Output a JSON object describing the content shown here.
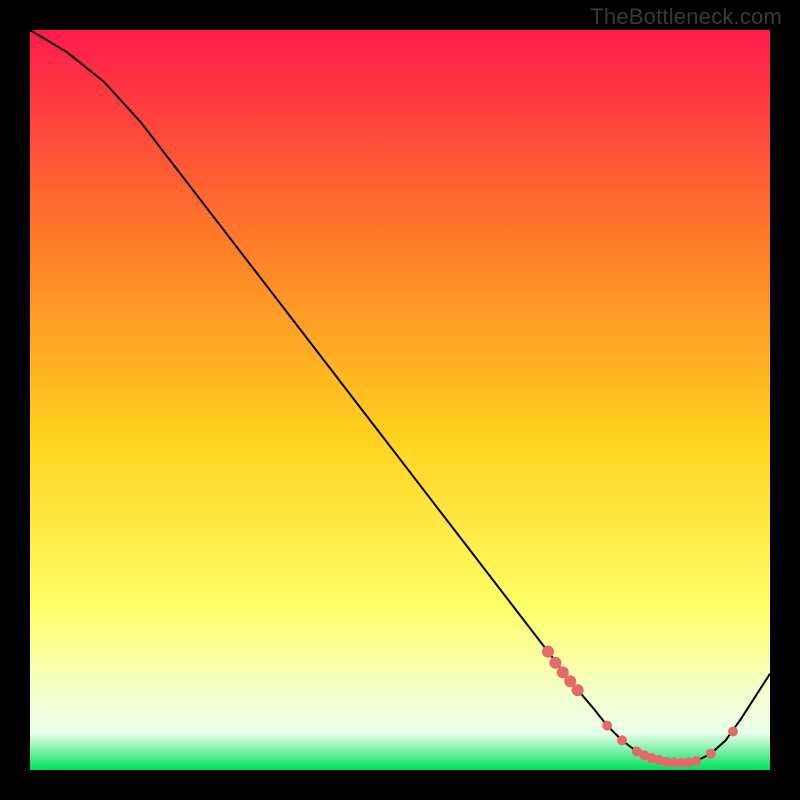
{
  "watermark": "TheBottleneck.com",
  "colors": {
    "gradient_top": "#ff1a4b",
    "gradient_mid1": "#ff7a2a",
    "gradient_mid2": "#ffd21f",
    "gradient_mid3": "#ffff66",
    "gradient_bottom_pale": "#eaffea",
    "gradient_bottom": "#00e05a",
    "curve": "#000000",
    "marker": "#e56a6a"
  },
  "chart_data": {
    "type": "line",
    "title": "",
    "xlabel": "",
    "ylabel": "",
    "xlim": [
      0,
      100
    ],
    "ylim": [
      0,
      100
    ],
    "grid": false,
    "legend": false,
    "series": [
      {
        "name": "bottleneck-curve",
        "x": [
          0,
          5,
          10,
          15,
          20,
          25,
          30,
          35,
          40,
          45,
          50,
          55,
          60,
          65,
          70,
          73,
          76,
          78,
          80,
          82,
          84,
          86,
          88,
          90,
          92,
          94,
          96,
          100
        ],
        "y": [
          100,
          97,
          93,
          87.5,
          81,
          74.5,
          68,
          61.5,
          55,
          48.5,
          42,
          35.5,
          29,
          22.5,
          16,
          12,
          8.5,
          6,
          4,
          2.5,
          1.6,
          1.1,
          1,
          1.2,
          2.2,
          4,
          6.8,
          13
        ]
      }
    ],
    "markers": {
      "name": "highlight-points",
      "x": [
        70,
        71,
        72,
        73,
        74,
        78,
        80,
        82,
        83,
        84,
        85,
        86,
        87,
        88,
        89,
        90,
        92,
        95
      ],
      "y": [
        16,
        14.5,
        13.2,
        12,
        10.8,
        6,
        4,
        2.5,
        2.0,
        1.6,
        1.35,
        1.1,
        1.03,
        1,
        1.05,
        1.2,
        2.2,
        5.2
      ]
    }
  }
}
